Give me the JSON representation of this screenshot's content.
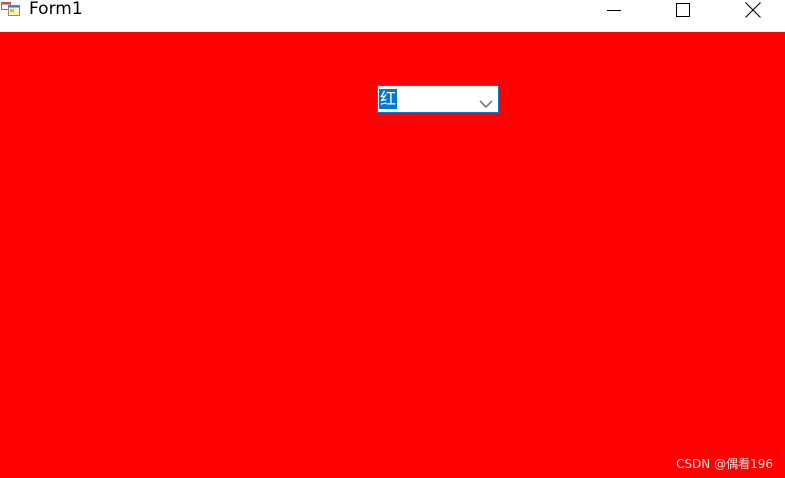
{
  "window": {
    "title": "Form1",
    "icon": "winforms-app-icon",
    "controls": {
      "minimize_icon": "minimize-icon",
      "maximize_icon": "maximize-icon",
      "close_icon": "close-icon"
    }
  },
  "form": {
    "background_color": "#ff0000",
    "color_combo": {
      "value": "红",
      "selected_highlight": "#0078d7",
      "dropdown_icon": "chevron-down-icon"
    }
  },
  "watermark": "CSDN @偶看196"
}
